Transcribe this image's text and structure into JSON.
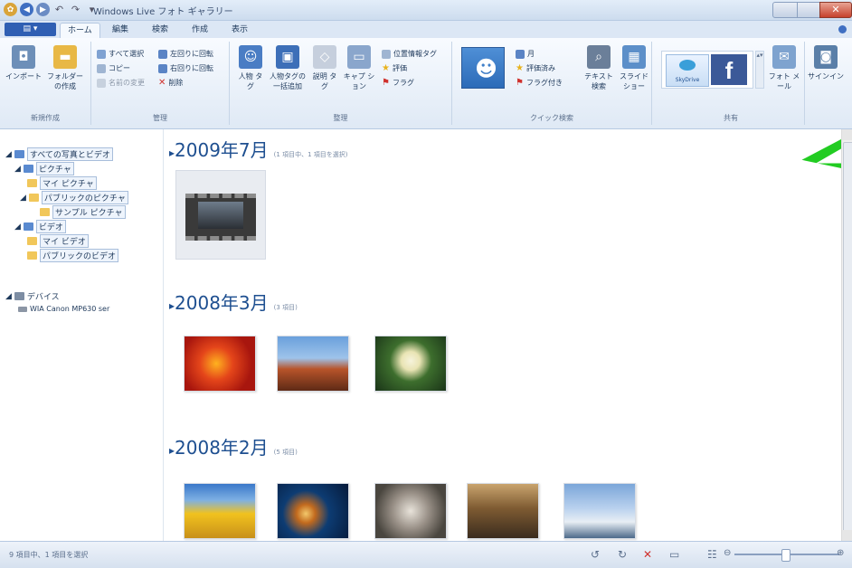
{
  "window": {
    "title": "Windows Live フォト ギャラリー"
  },
  "tabs": {
    "file_label": "",
    "items": [
      "ホーム",
      "編集",
      "検索",
      "作成",
      "表示"
    ]
  },
  "ribbon": {
    "new_group": {
      "label": "新規作成",
      "import": "インポート",
      "folder": "フォルダー の作成"
    },
    "manage_group": {
      "label": "管理",
      "select_all": "すべて選択",
      "copy": "コピー",
      "rename": "名前の変更",
      "rotate_left": "左回りに回転",
      "rotate_right": "右回りに回転",
      "delete": "削除"
    },
    "organize_group": {
      "label": "整理",
      "people_tag": "人物 タグ",
      "batch_people": "人物タグの 一括追加",
      "desc_tag": "説明 タグ",
      "caption": "キャプ ション",
      "geotag": "位置情報タグ",
      "rate": "評価",
      "flag": "フラグ"
    },
    "quickfind_group": {
      "label": "クイック検索",
      "month": "月",
      "rated": "評価済み",
      "flagged": "フラグ付き",
      "text_search": "テキスト 検索"
    },
    "slideshow": "スライド ショー",
    "share_group": {
      "label": "共有",
      "skydrive": "SkyDrive",
      "email": "フォト メール"
    },
    "signin": "サインイン"
  },
  "nav_tree": {
    "items": [
      {
        "label": "すべての写真とビデオ"
      },
      {
        "label": "ピクチャ"
      },
      {
        "label": "マイ ピクチャ"
      },
      {
        "label": "パブリックのピクチャ"
      },
      {
        "label": "サンプル ピクチャ"
      },
      {
        "label": "ビデオ"
      },
      {
        "label": "マイ ビデオ"
      },
      {
        "label": "パブリックのビデオ"
      },
      {
        "label": "デバイス"
      },
      {
        "label": "WIA Canon MP630 ser"
      }
    ]
  },
  "groups": [
    {
      "header": "2009年7月",
      "count": "(1 項目中、1 項目を選択)"
    },
    {
      "header": "2008年3月",
      "count": "(3 項目)"
    },
    {
      "header": "2008年2月",
      "count": "(5 項目)"
    }
  ],
  "status": {
    "text": "9 項目中、1 項目を選択"
  },
  "colors": {
    "accent": "#2f5fb3",
    "header": "#1e4f90",
    "arrow": "#22cc22"
  }
}
